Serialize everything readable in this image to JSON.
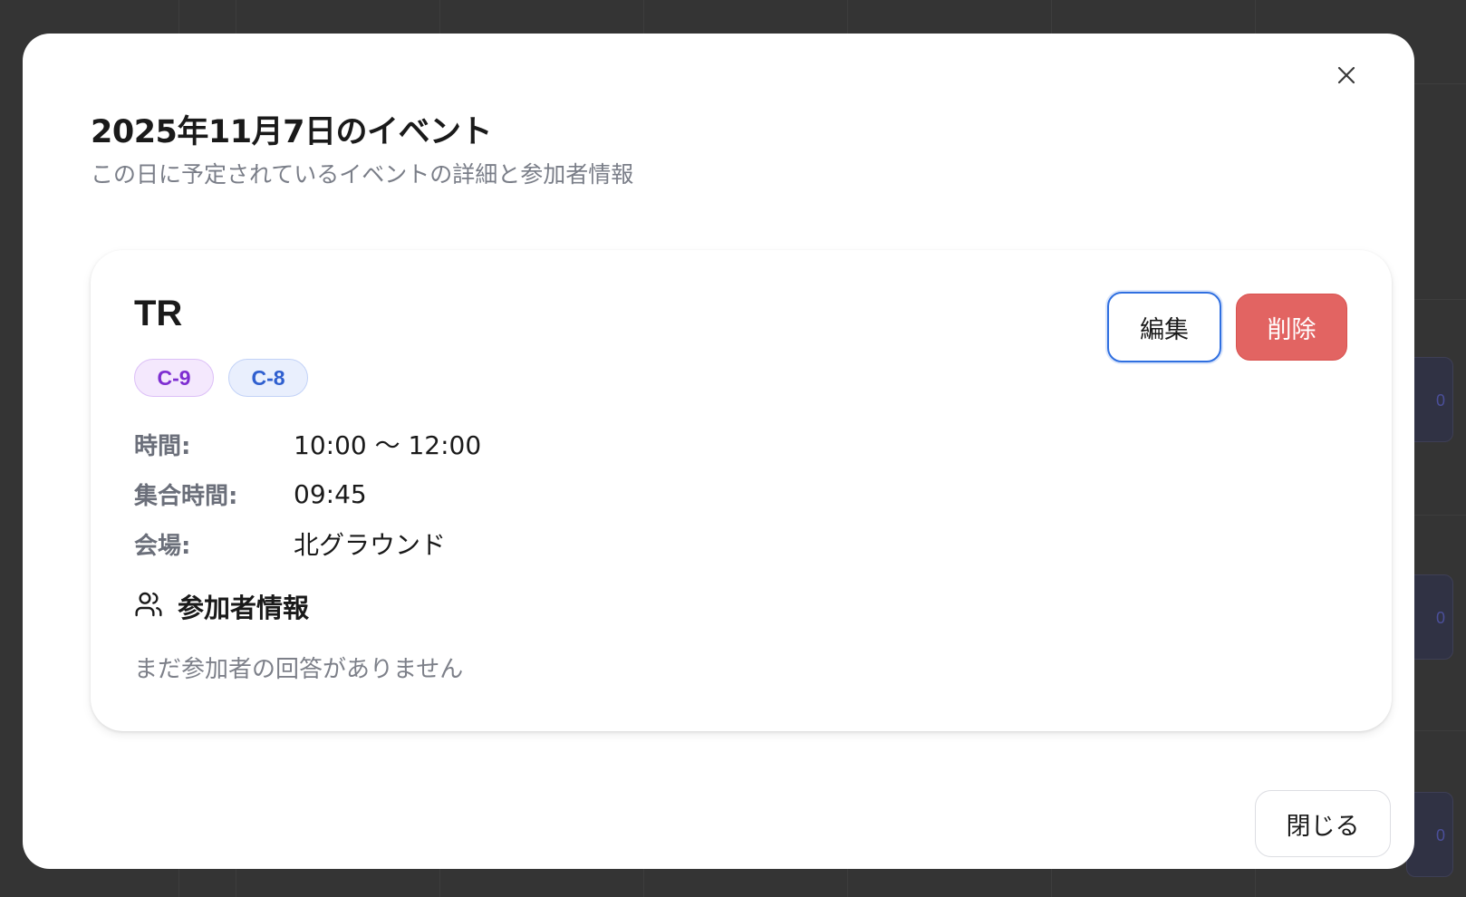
{
  "dialog": {
    "title": "2025年11月7日のイベント",
    "description": "この日に予定されているイベントの詳細と参加者情報",
    "close_icon": "close-icon",
    "footer_close_label": "閉じる"
  },
  "event": {
    "title": "TR",
    "tags": [
      {
        "label": "C-9",
        "color": "#7e2ed1"
      },
      {
        "label": "C-8",
        "color": "#2f5fcf"
      }
    ],
    "details": [
      {
        "label": "時間:",
        "value": "10:00 〜 12:00"
      },
      {
        "label": "集合時間:",
        "value": "09:45"
      },
      {
        "label": "会場:",
        "value": "北グラウンド"
      }
    ],
    "edit_label": "編集",
    "delete_label": "削除",
    "participants": {
      "icon": "users-icon",
      "title": "参加者情報",
      "empty_message": "まだ参加者の回答がありません"
    }
  },
  "background": {
    "counts": [
      "0",
      "0",
      "0"
    ]
  },
  "colors": {
    "overlay": "#343434",
    "edit_border": "#2f6fe0",
    "delete_bg": "#e26462",
    "muted_text": "#7a7e88"
  }
}
